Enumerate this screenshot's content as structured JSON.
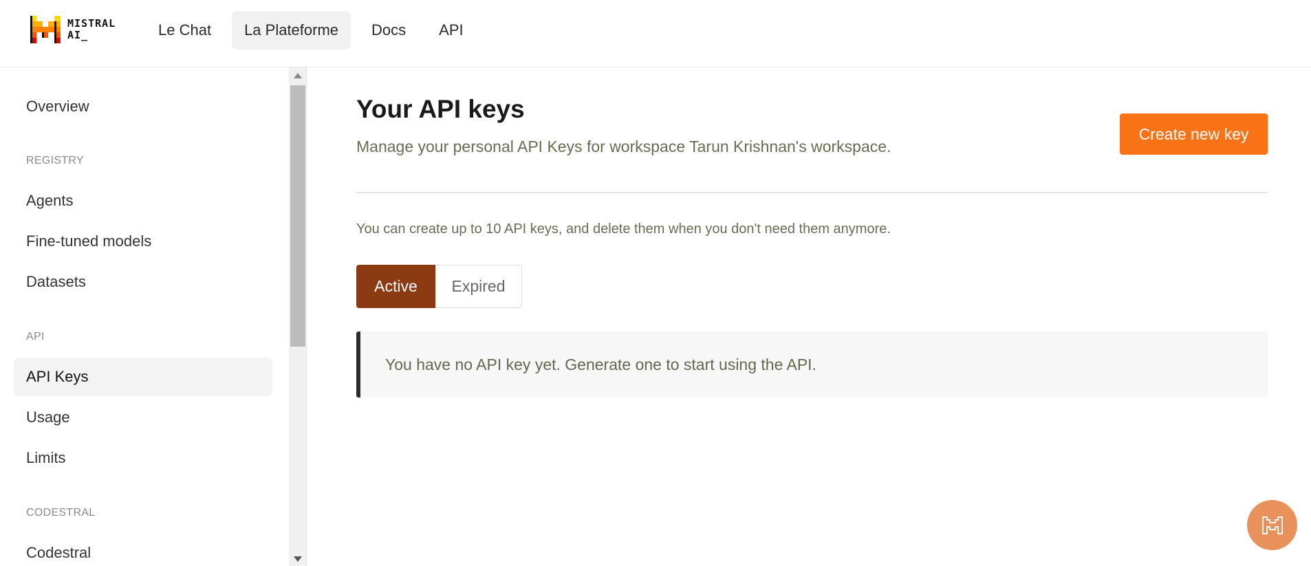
{
  "brand": {
    "logo_line1": "MISTRAL",
    "logo_line2": "AI_"
  },
  "nav": {
    "items": [
      {
        "label": "Le Chat"
      },
      {
        "label": "La Plateforme"
      },
      {
        "label": "Docs"
      },
      {
        "label": "API"
      }
    ],
    "active": "La Plateforme"
  },
  "sidebar": {
    "overview": "Overview",
    "registry_header": "REGISTRY",
    "agents": "Agents",
    "fine_tuned": "Fine-tuned models",
    "datasets": "Datasets",
    "api_header": "API",
    "api_keys": "API Keys",
    "usage": "Usage",
    "limits": "Limits",
    "codestral_header": "CODESTRAL",
    "codestral": "Codestral"
  },
  "main": {
    "title": "Your API keys",
    "subtitle": "Manage your personal API Keys for workspace Tarun Krishnan's workspace.",
    "create_button": "Create new key",
    "info": "You can create up to 10 API keys, and delete them when you don't need them anymore.",
    "tabs": {
      "active": "Active",
      "expired": "Expired"
    },
    "empty_message": "You have no API key yet. Generate one to start using the API."
  },
  "colors": {
    "accent": "#f97316",
    "active_tab": "#8b3a12",
    "fab": "#e8915b"
  }
}
